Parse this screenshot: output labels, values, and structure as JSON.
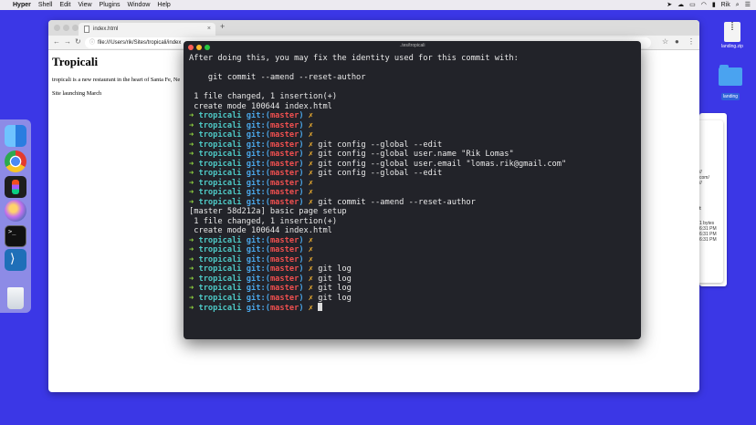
{
  "menubar": {
    "app": "Hyper",
    "items": [
      "Shell",
      "Edit",
      "View",
      "Plugins",
      "Window",
      "Help"
    ],
    "user": "Rik"
  },
  "desktop": {
    "items": [
      {
        "label": "landing.zip",
        "icon": "zip-file-icon"
      },
      {
        "label": "landing",
        "icon": "folder-icon"
      }
    ]
  },
  "dock": {
    "apps": [
      {
        "name": "finder-icon",
        "color": "#2d8cf0"
      },
      {
        "name": "chrome-icon",
        "color": "#e33b2e"
      },
      {
        "name": "figma-icon",
        "color": "#1e1e1e"
      },
      {
        "name": "photos-icon",
        "color": "#b96ac9"
      },
      {
        "name": "terminal-icon",
        "color": "#1a1a1a"
      },
      {
        "name": "vscode-icon",
        "color": "#1f6fb8"
      },
      {
        "name": "trash-icon",
        "color": "#d9dee4"
      }
    ]
  },
  "browser": {
    "tab_title": "index.html",
    "url": "file:///Users/rik/Sites/tropicali/index",
    "page": {
      "heading": "Tropicali",
      "intro": "tropicali is a new restaurant in the heart of Santa Fe, Ne",
      "launch": "Site launching March"
    }
  },
  "terminal": {
    "title": "..tes/tropicali",
    "prompt": {
      "arrow": "➜",
      "dir": "tropicali",
      "git": "git:(",
      "branch": "master",
      "close": ")",
      "dirty": "✗"
    },
    "lines": [
      {
        "type": "out",
        "text": "After doing this, you may fix the identity used for this commit with:"
      },
      {
        "type": "out",
        "text": ""
      },
      {
        "type": "out",
        "text": "    git commit --amend --reset-author"
      },
      {
        "type": "out",
        "text": ""
      },
      {
        "type": "out",
        "text": " 1 file changed, 1 insertion(+)"
      },
      {
        "type": "out",
        "text": " create mode 100644 index.html"
      },
      {
        "type": "prompt",
        "cmd": ""
      },
      {
        "type": "prompt",
        "cmd": ""
      },
      {
        "type": "prompt",
        "cmd": ""
      },
      {
        "type": "prompt",
        "cmd": "git config --global --edit"
      },
      {
        "type": "prompt",
        "cmd": "git config --global user.name \"Rik Lomas\""
      },
      {
        "type": "prompt",
        "cmd": "git config --global user.email \"lomas.rik@gmail.com\""
      },
      {
        "type": "prompt",
        "cmd": "git config --global --edit"
      },
      {
        "type": "prompt",
        "cmd": ""
      },
      {
        "type": "prompt",
        "cmd": ""
      },
      {
        "type": "prompt",
        "cmd": "git commit --amend --reset-author"
      },
      {
        "type": "out",
        "text": "[master 58d212a] basic page setup"
      },
      {
        "type": "out",
        "text": " 1 file changed, 1 insertion(+)"
      },
      {
        "type": "out",
        "text": " create mode 100644 index.html"
      },
      {
        "type": "prompt",
        "cmd": ""
      },
      {
        "type": "prompt",
        "cmd": ""
      },
      {
        "type": "prompt",
        "cmd": ""
      },
      {
        "type": "prompt",
        "cmd": "git log"
      },
      {
        "type": "prompt",
        "cmd": "git log"
      },
      {
        "type": "prompt",
        "cmd": "git log"
      },
      {
        "type": "prompt",
        "cmd": "git log"
      },
      {
        "type": "prompt",
        "cmd": "",
        "cursor": true
      }
    ]
  },
  "finder_fragments": [
    "//",
    "com/",
    "//",
    "t",
    "1 bytes",
    "6:31 PM",
    "6:31 PM",
    "6:31 PM"
  ]
}
